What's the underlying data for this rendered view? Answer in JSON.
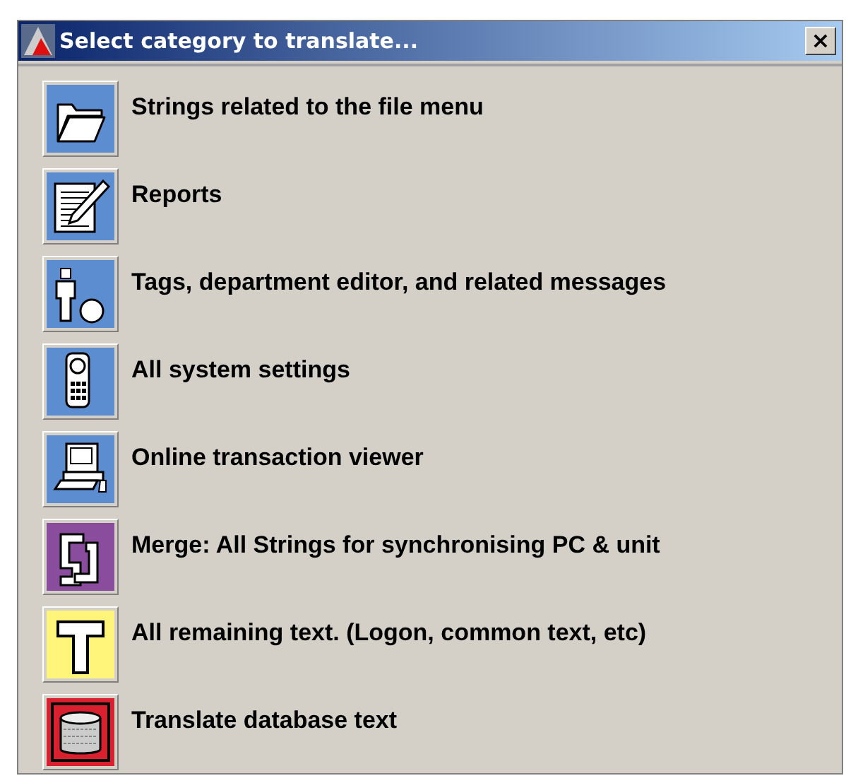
{
  "window": {
    "title": "Select category to translate...",
    "close": "×"
  },
  "categories": [
    {
      "kind": "folder",
      "label": "Strings related to the file menu"
    },
    {
      "kind": "report",
      "label": "Reports"
    },
    {
      "kind": "person",
      "label": "Tags, department editor, and related messages"
    },
    {
      "kind": "remote",
      "label": "All system settings"
    },
    {
      "kind": "terminal",
      "label": "Online transaction viewer"
    },
    {
      "kind": "merge",
      "label": "Merge: All Strings for synchronising PC & unit"
    },
    {
      "kind": "text",
      "label": "All remaining text. (Logon, common text, etc)"
    },
    {
      "kind": "database",
      "label": "Translate database text"
    }
  ]
}
